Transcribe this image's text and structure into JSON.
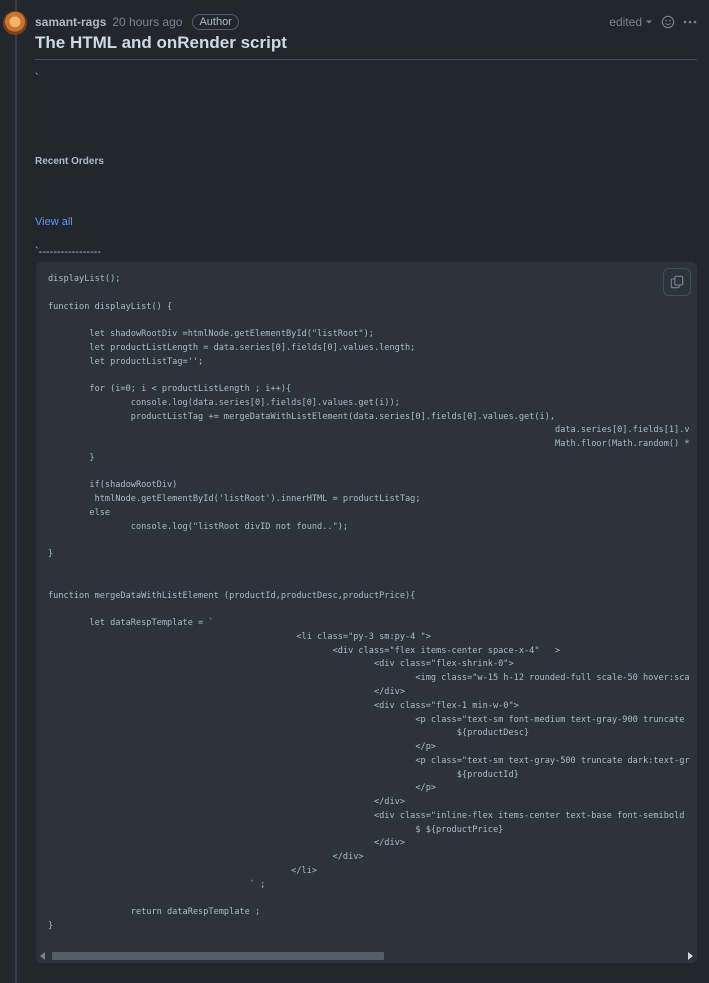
{
  "comment": {
    "author": "samant-rags",
    "time_ago": "20 hours ago",
    "badge": "Author",
    "edited_label": "edited",
    "title": "The HTML and onRender script",
    "backtick_line": "`",
    "recent_orders": "Recent Orders",
    "view_all": "View all",
    "dashes_line": "`-----------------"
  },
  "code": {
    "content": "displayList();\n\nfunction displayList() {\n\n        let shadowRootDiv =htmlNode.getElementById(\"listRoot\");\n        let productListLength = data.series[0].fields[0].values.length;\n        let productListTag='';\n\n        for (i=0; i < productListLength ; i++){\n                console.log(data.series[0].fields[0].values.get(i));\n                productListTag += mergeDataWithListElement(data.series[0].fields[0].values.get(i),\n                                                                                                  data.series[0].fields[1].v\n                                                                                                  Math.floor(Math.random() *\n        }\n\n        if(shadowRootDiv)\n         htmlNode.getElementById('listRoot').innerHTML = productListTag;\n        else\n                console.log(\"listRoot divID not found..\");\n\n}\n\n\nfunction mergeDataWithListElement (productId,productDesc,productPrice){\n\n        let dataRespTemplate = `\n                                                <li class=\"py-3 sm:py-4 \">\n                                                       <div class=\"flex items-center space-x-4\"   >\n                                                               <div class=\"flex-shrink-0\">\n                                                                       <img class=\"w-15 h-12 rounded-full scale-50 hover:sca\n                                                               </div>\n                                                               <div class=\"flex-1 min-w-0\">\n                                                                       <p class=\"text-sm font-medium text-gray-900 truncate\n                                                                               ${productDesc}\n                                                                       </p>\n                                                                       <p class=\"text-sm text-gray-500 truncate dark:text-gr\n                                                                               ${productId}\n                                                                       </p>\n                                                               </div>\n                                                               <div class=\"inline-flex items-center text-base font-semibold\n                                                                       $ ${productPrice}\n                                                               </div>\n                                                       </div>\n                                               </li>\n                                       ` ;\n\n                return dataRespTemplate ;\n}"
  },
  "icons": {
    "copy": "copy-icon",
    "smiley": "smiley-icon",
    "kebab": "kebab-menu-icon",
    "caret": "caret-down-icon"
  },
  "colors": {
    "background": "#22272e",
    "code_background": "#2d333b",
    "link": "#539bf5",
    "text": "#adbac7"
  }
}
